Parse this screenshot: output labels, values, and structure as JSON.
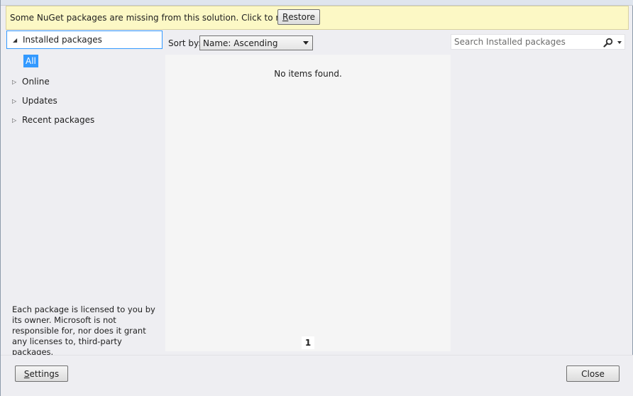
{
  "infobar": {
    "message": "Some NuGet packages are missing from this solution. Click to restore.",
    "restore_accel": "R",
    "restore_rest": "estore"
  },
  "tree": {
    "items": [
      {
        "label": "Installed packages",
        "expanded": true,
        "selected": true
      },
      {
        "label": "Online",
        "expanded": false
      },
      {
        "label": "Updates",
        "expanded": false
      },
      {
        "label": "Recent packages",
        "expanded": false
      }
    ],
    "child_selected": "All"
  },
  "disclaimer": "Each package is licensed to you by its owner. Microsoft is not responsible for, nor does it grant any licenses to, third-party packages.",
  "sort": {
    "label": "Sort by:",
    "selected": "Name: Ascending"
  },
  "list": {
    "empty_message": "No items found.",
    "page": "1"
  },
  "search": {
    "placeholder": "Search Installed packages",
    "value": ""
  },
  "footer": {
    "settings_accel": "S",
    "settings_rest": "ettings",
    "close_label": "Close"
  },
  "colors": {
    "infobar_bg": "#fcf8c5",
    "selection": "#3399ff",
    "panel_bg": "#eeeef2"
  }
}
